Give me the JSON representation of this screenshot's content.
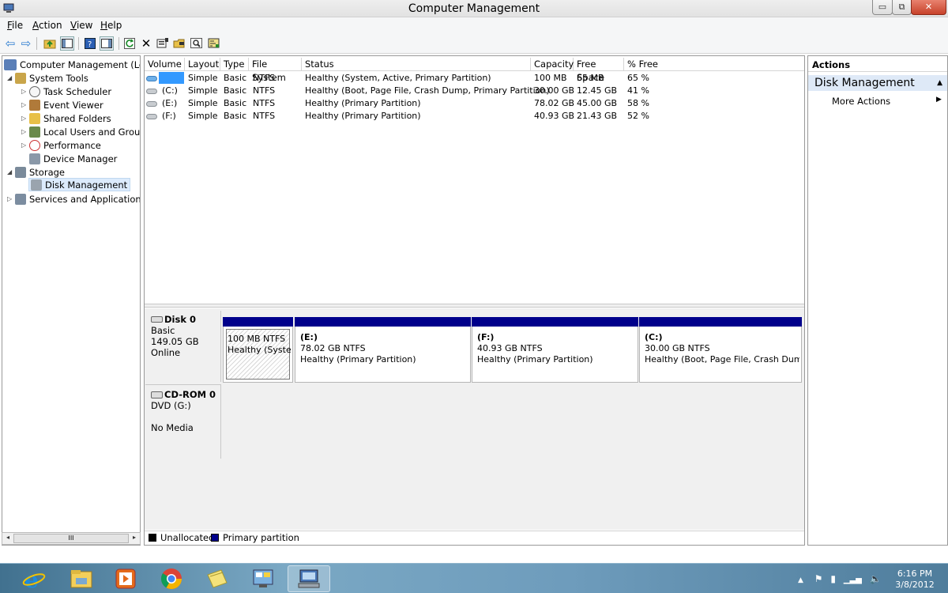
{
  "window": {
    "title": "Computer Management",
    "minimize_glyph": "▭",
    "maximize_glyph": "⧉",
    "close_glyph": "✕"
  },
  "menu": {
    "file": "File",
    "action": "Action",
    "view": "View",
    "help": "Help"
  },
  "tree": {
    "root": "Computer Management (Local",
    "system_tools": "System Tools",
    "task_scheduler": "Task Scheduler",
    "event_viewer": "Event Viewer",
    "shared_folders": "Shared Folders",
    "local_users": "Local Users and Groups",
    "performance": "Performance",
    "device_manager": "Device Manager",
    "storage": "Storage",
    "disk_management": "Disk Management",
    "services": "Services and Applications",
    "scroll_thumb": "III"
  },
  "volume_list": {
    "columns": [
      "Volume",
      "Layout",
      "Type",
      "File System",
      "Status",
      "Capacity",
      "Free Space",
      "% Free"
    ],
    "rows": [
      {
        "volume": "",
        "layout": "Simple",
        "type": "Basic",
        "fs": "NTFS",
        "status": "Healthy (System, Active, Primary Partition)",
        "capacity": "100 MB",
        "free": "65 MB",
        "pct": "65 %"
      },
      {
        "volume": "(C:)",
        "layout": "Simple",
        "type": "Basic",
        "fs": "NTFS",
        "status": "Healthy (Boot, Page File, Crash Dump, Primary Partition)",
        "capacity": "30.00 GB",
        "free": "12.45 GB",
        "pct": "41 %"
      },
      {
        "volume": "(E:)",
        "layout": "Simple",
        "type": "Basic",
        "fs": "NTFS",
        "status": "Healthy (Primary Partition)",
        "capacity": "78.02 GB",
        "free": "45.00 GB",
        "pct": "58 %"
      },
      {
        "volume": "(F:)",
        "layout": "Simple",
        "type": "Basic",
        "fs": "NTFS",
        "status": "Healthy (Primary Partition)",
        "capacity": "40.93 GB",
        "free": "21.43 GB",
        "pct": "52 %"
      }
    ]
  },
  "disk0": {
    "name": "Disk 0",
    "type": "Basic",
    "size": "149.05 GB",
    "state": "Online",
    "partitions": [
      {
        "label": "",
        "size": "100 MB NTFS",
        "status": "Healthy (Systen"
      },
      {
        "label": "(E:)",
        "size": "78.02 GB NTFS",
        "status": "Healthy (Primary Partition)"
      },
      {
        "label": "(F:)",
        "size": "40.93 GB NTFS",
        "status": "Healthy (Primary Partition)"
      },
      {
        "label": "(C:)",
        "size": "30.00 GB NTFS",
        "status": "Healthy (Boot, Page File, Crash Dump,"
      }
    ]
  },
  "cdrom": {
    "name": "CD-ROM 0",
    "type": "DVD (G:)",
    "state": "No Media"
  },
  "legend": {
    "unallocated": "Unallocated",
    "primary": "Primary partition",
    "unallocated_color": "#000000",
    "primary_color": "#00008b"
  },
  "actions": {
    "title": "Actions",
    "section": "Disk Management",
    "more": "More Actions"
  },
  "taskbar": {
    "time": "6:16 PM",
    "date": "3/8/2012"
  }
}
